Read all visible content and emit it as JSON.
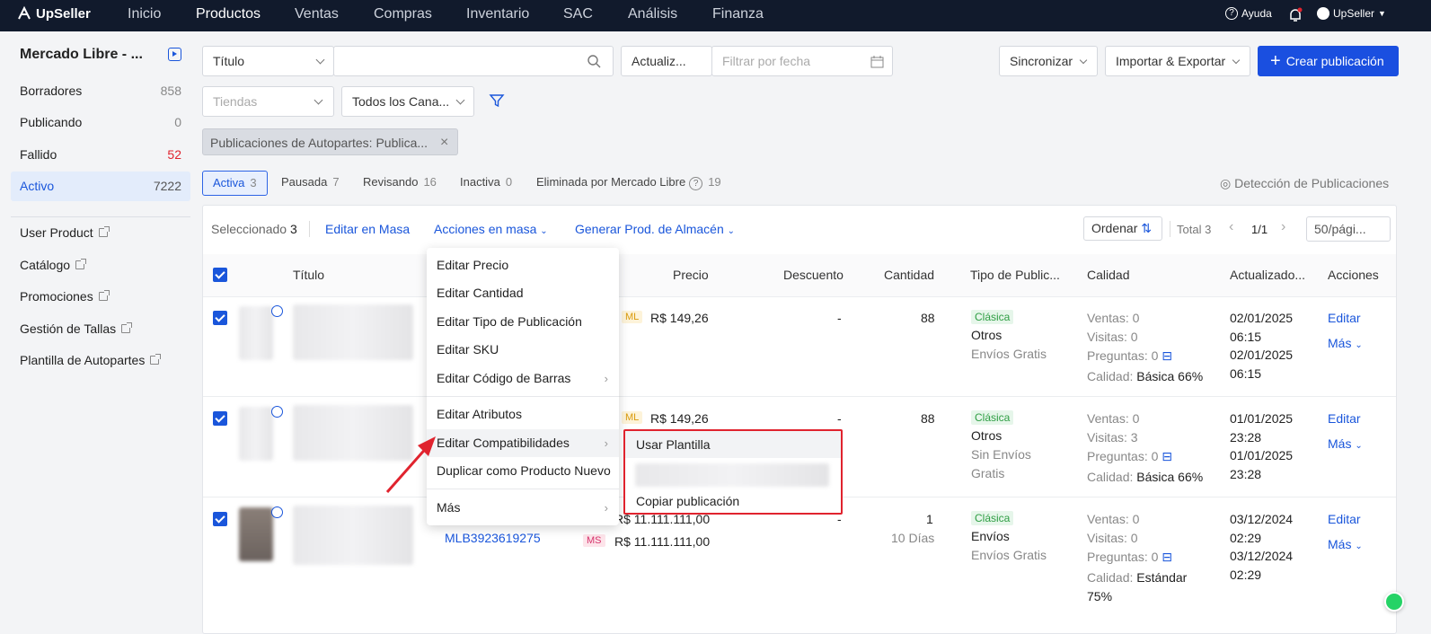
{
  "topnav": {
    "brand": "UpSeller",
    "items": [
      "Inicio",
      "Productos",
      "Ventas",
      "Compras",
      "Inventario",
      "SAC",
      "Análisis",
      "Finanza"
    ],
    "active": "Productos",
    "help": "Ayuda",
    "user": "UpSeller"
  },
  "sidebar": {
    "title": "Mercado Libre - ...",
    "statuses": [
      {
        "label": "Borradores",
        "count": "858"
      },
      {
        "label": "Publicando",
        "count": "0"
      },
      {
        "label": "Fallido",
        "count": "52"
      },
      {
        "label": "Activo",
        "count": "7222"
      }
    ],
    "links": [
      "User Product",
      "Catálogo",
      "Promociones",
      "Gestión de Tallas",
      "Plantilla de Autopartes"
    ]
  },
  "filters": {
    "field_select": "Título",
    "search_value": "",
    "date_select": "Actualiz...",
    "date_placeholder": "Filtrar por fecha",
    "stores_placeholder": "Tiendas",
    "channels_select": "Todos los Cana...",
    "sync": "Sincronizar",
    "import_export": "Importar & Exportar",
    "create": "Crear publicación",
    "active_tag": "Publicaciones de Autopartes: Publica..."
  },
  "tabs": [
    {
      "label": "Activa",
      "count": "3"
    },
    {
      "label": "Pausada",
      "count": "7"
    },
    {
      "label": "Revisando",
      "count": "16"
    },
    {
      "label": "Inactiva",
      "count": "0"
    },
    {
      "label": "Eliminada por Mercado Libre",
      "count": "19"
    }
  ],
  "detection": "Detección de Publicaciones",
  "toolbar": {
    "selected_label": "Seleccionado",
    "selected_count": "3",
    "bulk_edit": "Editar en Masa",
    "bulk_actions": "Acciones en masa",
    "generate": "Generar Prod. de Almacén",
    "sort": "Ordenar",
    "total": "Total 3",
    "page": "1/1",
    "per_page": "50/pági..."
  },
  "table": {
    "headers": [
      "Título",
      "Precio",
      "Descuento",
      "Cantidad",
      "Tipo de Public...",
      "Calidad",
      "Actualizado...",
      "Acciones"
    ],
    "rows": [
      {
        "price": "R$ 149,26",
        "badge": "ML",
        "discount": "-",
        "qty": "88",
        "qty_sub": "",
        "type_badge": "Clásica",
        "type1": "Otros",
        "type2": "Envíos Gratis",
        "ventas": "Ventas: 0",
        "visitas": "Visitas: 0",
        "preg": "Preguntas: 0",
        "cal_label": "Calidad:",
        "cal_val": "Básica 66%",
        "date1": "02/01/2025",
        "time1": "06:15",
        "date2": "02/01/2025",
        "time2": "06:15",
        "edit": "Editar",
        "more": "Más"
      },
      {
        "price": "R$ 149,26",
        "badge": "ML",
        "discount": "-",
        "qty": "88",
        "qty_sub": "",
        "type_badge": "Clásica",
        "type1": "Otros",
        "type2": "Sin Envíos",
        "type3": "Gratis",
        "ventas": "Ventas: 0",
        "visitas": "Visitas: 3",
        "preg": "Preguntas: 0",
        "cal_label": "Calidad:",
        "cal_val": "Básica 66%",
        "date1": "01/01/2025",
        "time1": "23:28",
        "date2": "01/01/2025",
        "time2": "23:28",
        "edit": "Editar",
        "more": "Más"
      },
      {
        "price": "R$ 11.111.111,00",
        "price2": "R$ 11.111.111,00",
        "badge2": "MS",
        "mlb": "MLB3923619275",
        "discount": "-",
        "qty": "1",
        "qty_sub": "10 Días",
        "type_badge": "Clásica",
        "type1": "Envíos",
        "type2": "Envíos Gratis",
        "ventas": "Ventas: 0",
        "visitas": "Visitas: 0",
        "preg": "Preguntas: 0",
        "cal_label": "Calidad:",
        "cal_val": "Estándar",
        "cal_val2": "75%",
        "date1": "03/12/2024",
        "time1": "02:29",
        "date2": "03/12/2024",
        "time2": "02:29",
        "edit": "Editar",
        "more": "Más"
      }
    ]
  },
  "menu": {
    "items": [
      "Editar Precio",
      "Editar Cantidad",
      "Editar Tipo de Publicación",
      "Editar SKU",
      "Editar Código de Barras",
      "Editar Atributos",
      "Editar Compatibilidades",
      "Duplicar como Producto Nuevo",
      "Más"
    ]
  },
  "submenu": {
    "items": [
      "Usar Plantilla",
      "Copiar publicación"
    ]
  },
  "colors": {
    "accent": "#1a4fe0",
    "nav_bg": "#111a2c",
    "highlight": "#e0232e"
  }
}
